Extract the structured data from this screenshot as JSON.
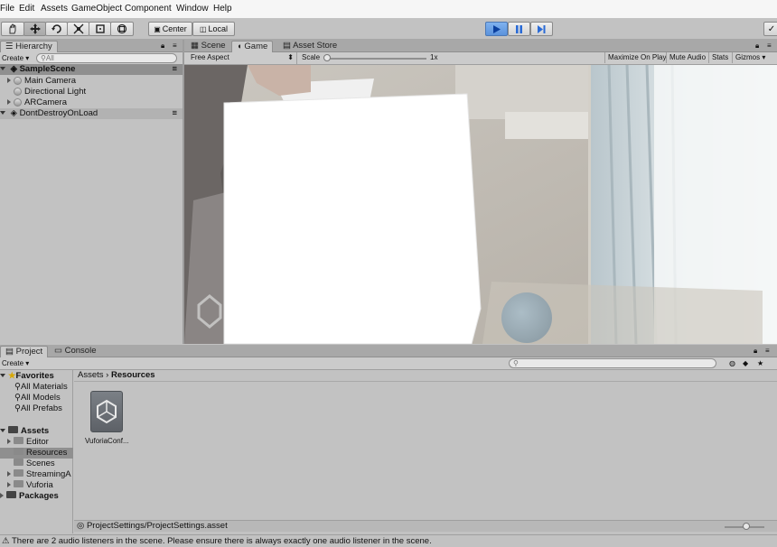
{
  "menu": [
    "File",
    "Edit",
    "Assets",
    "GameObject",
    "Component",
    "Window",
    "Help"
  ],
  "toolbar": {
    "tools": [
      "hand-tool-icon",
      "move-tool-icon",
      "rotate-tool-icon",
      "scale-tool-icon",
      "rect-tool-icon",
      "transform-tool-icon"
    ],
    "pivot": "Center",
    "space": "Local"
  },
  "hierarchy": {
    "tab": "Hierarchy",
    "create": "Create",
    "search_placeholder": "All",
    "scene": "SampleScene",
    "items": [
      "Main Camera",
      "Directional Light",
      "ARCamera"
    ],
    "dontdestroy": "DontDestroyOnLoad"
  },
  "view_tabs": {
    "scene": "Scene",
    "game": "Game",
    "store": "Asset Store"
  },
  "game_bar": {
    "aspect": "Free Aspect",
    "scale_label": "Scale",
    "scale_value": "1x",
    "maximize": "Maximize On Play",
    "mute": "Mute Audio",
    "stats": "Stats",
    "gizmos": "Gizmos"
  },
  "project": {
    "tab": "Project",
    "console_tab": "Console",
    "create": "Create",
    "favorites": "Favorites",
    "fav_items": [
      "All Materials",
      "All Models",
      "All Prefabs"
    ],
    "assets": "Assets",
    "asset_items": [
      "Editor",
      "Resources",
      "Scenes",
      "StreamingA",
      "Vuforia"
    ],
    "packages": "Packages",
    "breadcrumb_root": "Assets",
    "breadcrumb_current": "Resources",
    "file_name": "VuforiaConf...",
    "footer_path": "ProjectSettings/ProjectSettings.asset"
  },
  "status": "There are 2 audio listeners in the scene. Please ensure there is always exactly one audio listener in the scene."
}
